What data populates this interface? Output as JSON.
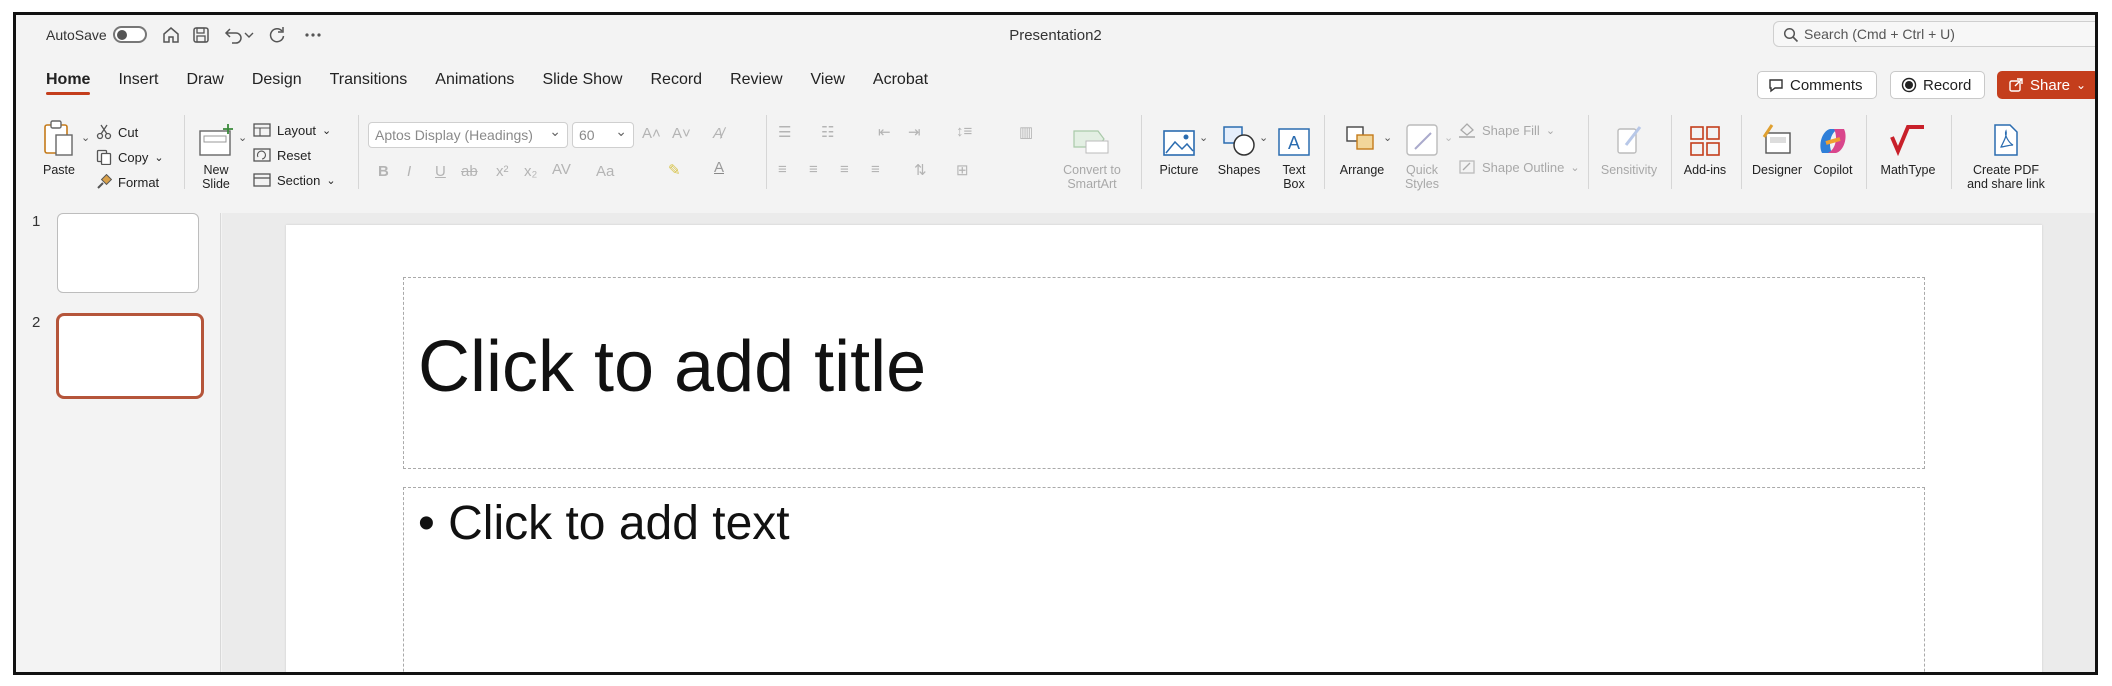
{
  "titlebar": {
    "autosave_label": "AutoSave",
    "document_title": "Presentation2",
    "search_placeholder": "Search (Cmd + Ctrl + U)"
  },
  "tabs": [
    {
      "label": "Home",
      "active": true
    },
    {
      "label": "Insert"
    },
    {
      "label": "Draw"
    },
    {
      "label": "Design"
    },
    {
      "label": "Transitions"
    },
    {
      "label": "Animations"
    },
    {
      "label": "Slide Show"
    },
    {
      "label": "Record"
    },
    {
      "label": "Review"
    },
    {
      "label": "View"
    },
    {
      "label": "Acrobat"
    }
  ],
  "header_buttons": {
    "comments": "Comments",
    "record": "Record",
    "share": "Share"
  },
  "ribbon": {
    "paste": "Paste",
    "cut": "Cut",
    "copy": "Copy",
    "format": "Format",
    "new_slide_line1": "New",
    "new_slide_line2": "Slide",
    "layout": "Layout",
    "reset": "Reset",
    "section": "Section",
    "font_name": "Aptos Display (Headings)",
    "font_size": "60",
    "convert_smartart_line1": "Convert to",
    "convert_smartart_line2": "SmartArt",
    "picture": "Picture",
    "shapes": "Shapes",
    "textbox_line1": "Text",
    "textbox_line2": "Box",
    "arrange": "Arrange",
    "quick_styles_line1": "Quick",
    "quick_styles_line2": "Styles",
    "shape_fill": "Shape Fill",
    "shape_outline": "Shape Outline",
    "sensitivity": "Sensitivity",
    "addins": "Add-ins",
    "designer": "Designer",
    "copilot": "Copilot",
    "mathtype": "MathType",
    "create_pdf_line1": "Create PDF",
    "create_pdf_line2": "and share link"
  },
  "slides": [
    {
      "number": "1",
      "selected": false
    },
    {
      "number": "2",
      "selected": true
    }
  ],
  "slide": {
    "title_placeholder": "Click to add title",
    "body_placeholder": "• Click to add text"
  },
  "colors": {
    "accent": "#c43e1c",
    "thumbnail_selected": "#b5553a"
  }
}
